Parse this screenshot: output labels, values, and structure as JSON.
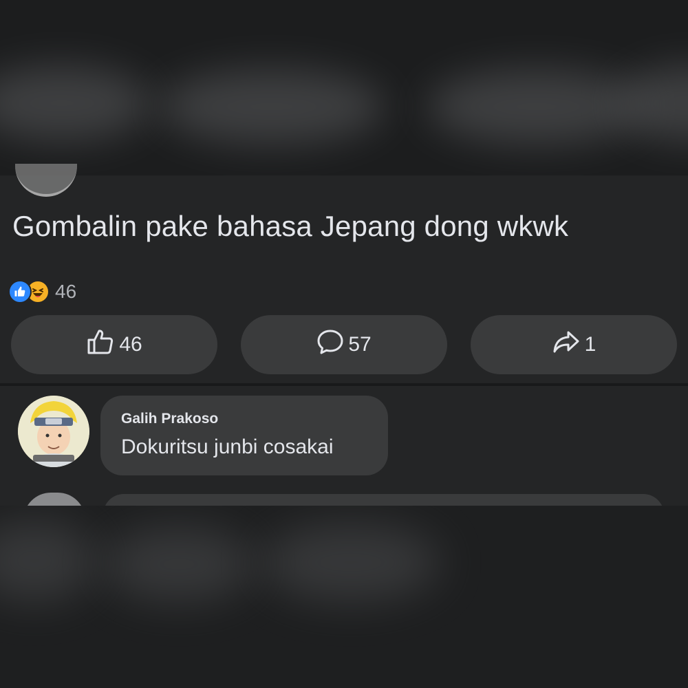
{
  "post": {
    "text": "Gombalin pake bahasa Jepang dong wkwk",
    "reactions": {
      "icons": [
        "like-icon",
        "haha-icon"
      ],
      "count": "46"
    }
  },
  "actions": {
    "like": {
      "icon": "thumbs-up-icon",
      "count": "46"
    },
    "comment": {
      "icon": "comment-bubble-icon",
      "count": "57"
    },
    "share": {
      "icon": "share-arrow-icon",
      "count": "1"
    }
  },
  "comments": [
    {
      "author": "Galih Prakoso",
      "text": "Dokuritsu junbi cosakai",
      "avatar": "avatar"
    }
  ],
  "colors": {
    "background": "#242526",
    "button": "#3a3b3c",
    "text": "#e4e6eb",
    "muted": "#b0b3b8",
    "like_blue": "#2d88ff",
    "haha_yellow": "#f7b125"
  }
}
